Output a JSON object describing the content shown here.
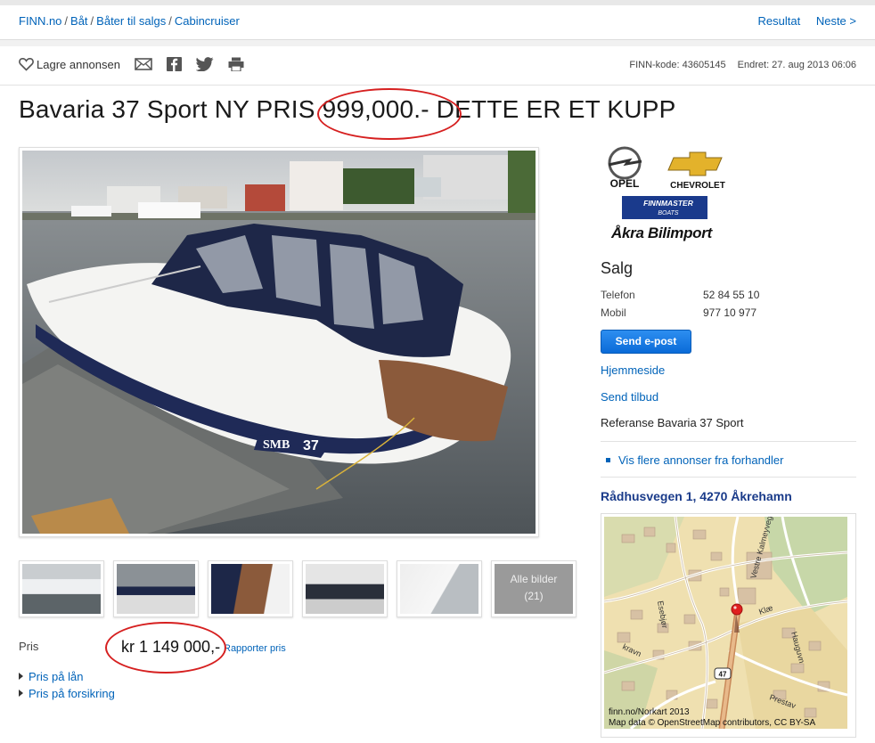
{
  "breadcrumb": {
    "items": [
      "FINN.no",
      "Båt",
      "Båter til salgs",
      "Cabincruiser"
    ],
    "separator": "/",
    "nav": [
      "Resultat",
      "Neste >"
    ]
  },
  "toolbar": {
    "save_label": "Lagre annonsen",
    "icons": [
      "heart-icon",
      "email-icon",
      "facebook-icon",
      "twitter-icon",
      "print-icon"
    ]
  },
  "meta": {
    "finn_code": "FINN-kode: 43605145",
    "edited": "Endret: 27. aug 2013 06:06"
  },
  "listing": {
    "title": "Bavaria 37 Sport NY PRIS 999,000.- DETTE ER ET KUPP",
    "price_label": "Pris",
    "price": "kr 1 149 000,-",
    "report_price": "Rapporter pris",
    "links": [
      "Pris på lån",
      "Pris på forsikring"
    ],
    "all_images_label": "Alle bilder",
    "all_images_count": "(21)"
  },
  "dealer": {
    "logo_texts": [
      "OPEL",
      "CHEVROLET",
      "FINNMASTER",
      "BOATS",
      "Åkra Bilimport"
    ],
    "heading": "Salg",
    "phone_label": "Telefon",
    "phone": "52 84 55 10",
    "mobile_label": "Mobil",
    "mobile": "977 10 977",
    "email_button": "Send e-post",
    "homepage": "Hjemmeside",
    "send_offer": "Send tilbud",
    "reference": "Referanse Bavaria 37 Sport",
    "more_ads": "Vis flere annonser fra forhandler"
  },
  "location": {
    "address": "Rådhusvegen 1, 4270 Åkrehamn",
    "map_credit1": "finn.no/Norkart 2013",
    "map_credit2": "Map data © OpenStreetMap contributors, CC BY-SA"
  },
  "colors": {
    "link": "#0063b9",
    "annotation": "#d62020",
    "button": "#0a6bd8"
  }
}
